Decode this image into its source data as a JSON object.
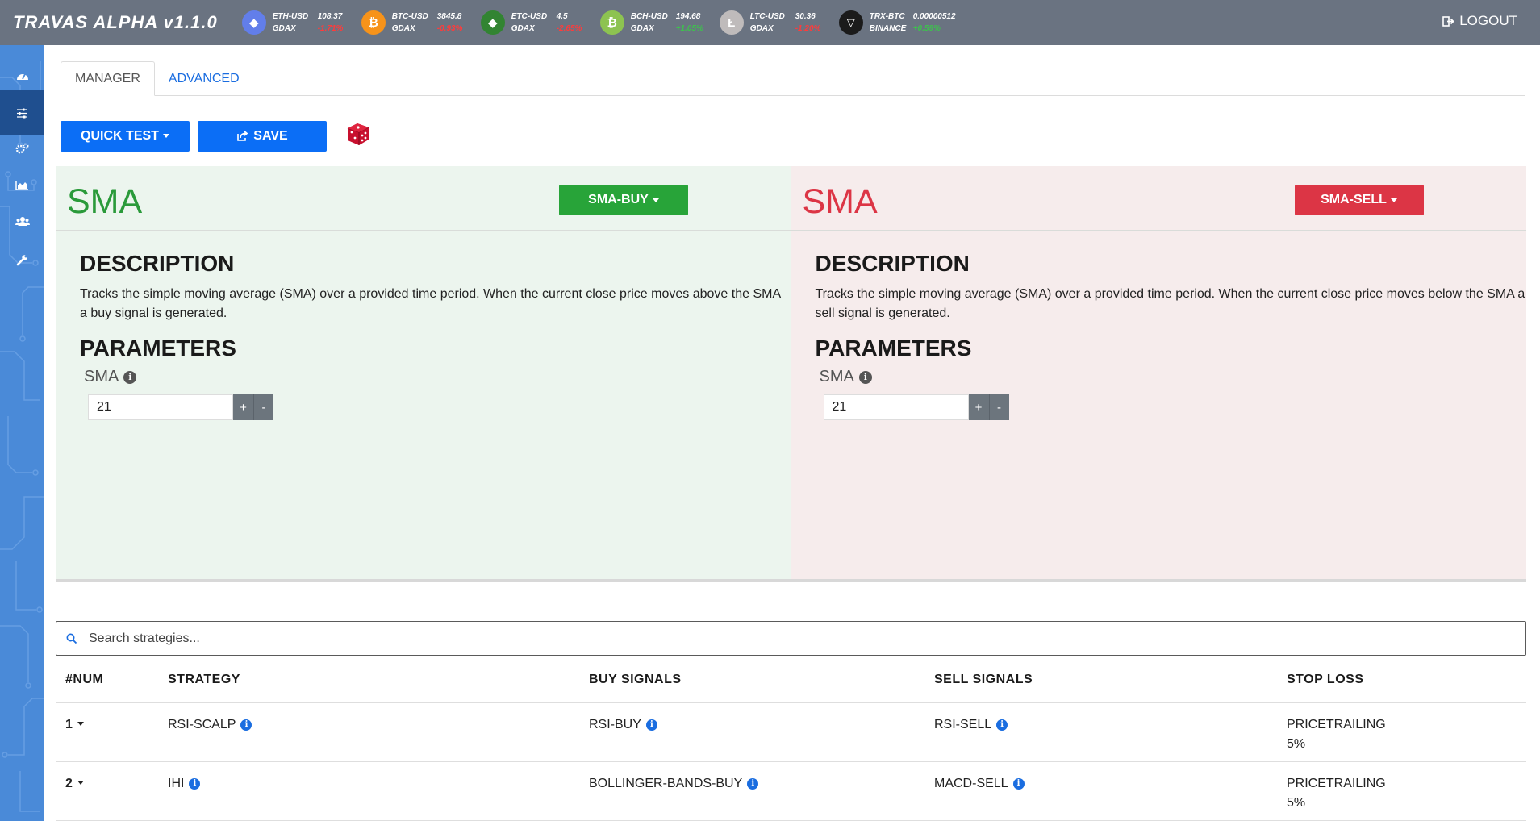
{
  "app": {
    "title": "TRAVAS ALPHA v1.1.0",
    "logout_label": "LOGOUT"
  },
  "tickers": [
    {
      "pair": "ETH-USD",
      "price": "108.37",
      "exchange": "GDAX",
      "change": "-1.71%",
      "trend": "down",
      "icon": "ethereum-icon",
      "color": "#627eea",
      "glyph": "◆"
    },
    {
      "pair": "BTC-USD",
      "price": "3845.8",
      "exchange": "GDAX",
      "change": "-0.93%",
      "trend": "down",
      "icon": "bitcoin-icon",
      "color": "#f7931a",
      "glyph": "₿"
    },
    {
      "pair": "ETC-USD",
      "price": "4.5",
      "exchange": "GDAX",
      "change": "-2.65%",
      "trend": "down",
      "icon": "ethereum-classic-icon",
      "color": "#328432",
      "glyph": "◆"
    },
    {
      "pair": "BCH-USD",
      "price": "194.68",
      "exchange": "GDAX",
      "change": "+1.05%",
      "trend": "up",
      "icon": "bitcoin-cash-icon",
      "color": "#8dc351",
      "glyph": "₿"
    },
    {
      "pair": "LTC-USD",
      "price": "30.36",
      "exchange": "GDAX",
      "change": "-1.20%",
      "trend": "down",
      "icon": "litecoin-icon",
      "color": "#bfbbbb",
      "glyph": "Ł"
    },
    {
      "pair": "TRX-BTC",
      "price": "0.00000512",
      "exchange": "BINANCE",
      "change": "+0.59%",
      "trend": "up",
      "icon": "tron-icon",
      "color": "#1b1b1b",
      "glyph": "▽"
    }
  ],
  "sidebar": [
    {
      "name": "dashboard-icon",
      "active": false
    },
    {
      "name": "sliders-icon",
      "active": true
    },
    {
      "name": "cogs-icon",
      "active": false
    },
    {
      "name": "area-chart-icon",
      "active": false
    },
    {
      "name": "users-icon",
      "active": false
    },
    {
      "name": "wrench-icon",
      "active": false
    }
  ],
  "tabs": {
    "manager": "MANAGER",
    "advanced": "ADVANCED"
  },
  "toolbar": {
    "quick_test": "QUICK TEST",
    "save": "SAVE"
  },
  "buy_panel": {
    "title": "SMA",
    "button": "SMA-BUY",
    "description_heading": "DESCRIPTION",
    "description": "Tracks the simple moving average (SMA) over a provided time period. When the current close price moves above the SMA a buy signal is generated.",
    "parameters_heading": "PARAMETERS",
    "param_label": "SMA",
    "param_value": "21",
    "plus": "+",
    "minus": "-"
  },
  "sell_panel": {
    "title": "SMA",
    "button": "SMA-SELL",
    "description_heading": "DESCRIPTION",
    "description": "Tracks the simple moving average (SMA) over a provided time period. When the current close price moves below the SMA a sell signal is generated.",
    "parameters_heading": "PARAMETERS",
    "param_label": "SMA",
    "param_value": "21",
    "plus": "+",
    "minus": "-"
  },
  "search": {
    "placeholder": "Search strategies..."
  },
  "table": {
    "headers": {
      "num": "#NUM",
      "strategy": "STRATEGY",
      "buy": "BUY SIGNALS",
      "sell": "SELL SIGNALS",
      "stop": "STOP LOSS"
    },
    "rows": [
      {
        "num": "1",
        "strategy": "RSI-SCALP",
        "buy": "RSI-BUY",
        "sell": "RSI-SELL",
        "stop_type": "PRICETRAILING",
        "stop_value": "5%"
      },
      {
        "num": "2",
        "strategy": "IHI",
        "buy": "BOLLINGER-BANDS-BUY",
        "sell": "MACD-SELL",
        "stop_type": "PRICETRAILING",
        "stop_value": "5%"
      }
    ]
  }
}
